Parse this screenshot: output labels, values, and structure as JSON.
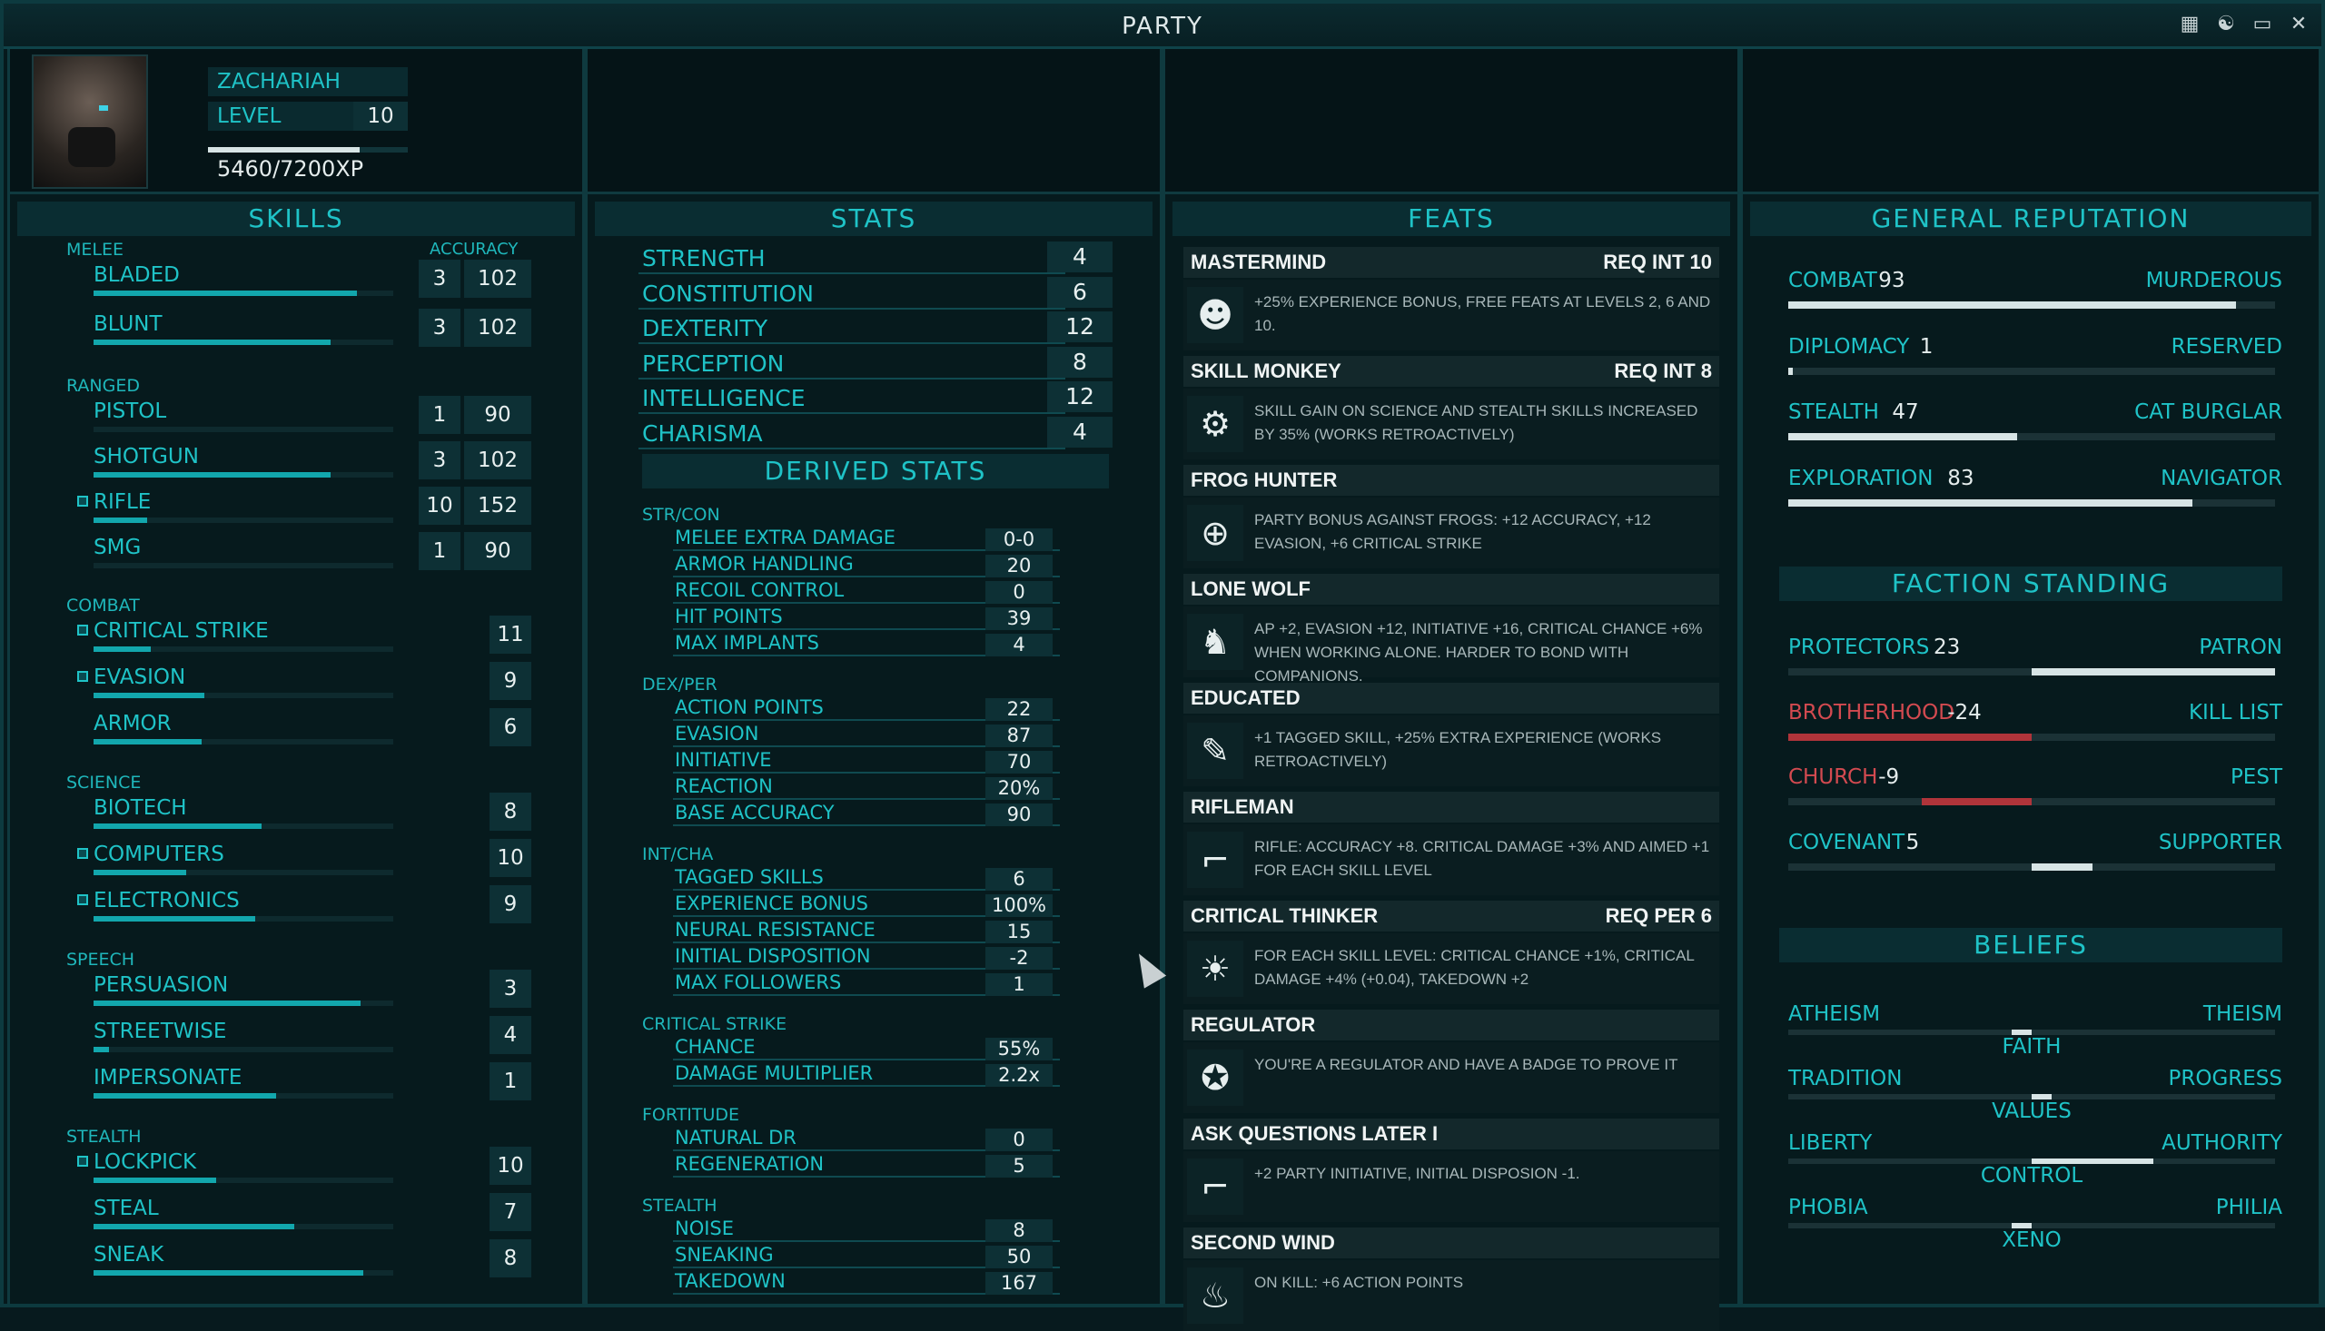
{
  "window": {
    "title": "PARTY"
  },
  "character": {
    "name": "ZACHARIAH",
    "level_label": "LEVEL",
    "level": "10",
    "xp": "5460/7200XP",
    "xp_fraction": 0.758
  },
  "skills": {
    "title": "SKILLS",
    "accuracy_header": "ACCURACY",
    "groups": [
      {
        "name": "MELEE",
        "items": [
          {
            "name": "BLADED",
            "rank": "3",
            "acc": "102",
            "fill": 0.88,
            "tagged": false
          },
          {
            "name": "BLUNT",
            "rank": "3",
            "acc": "102",
            "fill": 0.79,
            "tagged": false
          }
        ]
      },
      {
        "name": "RANGED",
        "items": [
          {
            "name": "PISTOL",
            "rank": "1",
            "acc": "90",
            "fill": 0,
            "tagged": false
          },
          {
            "name": "SHOTGUN",
            "rank": "3",
            "acc": "102",
            "fill": 0.79,
            "tagged": false
          },
          {
            "name": "RIFLE",
            "rank": "10",
            "acc": "152",
            "fill": 0.18,
            "tagged": true
          },
          {
            "name": "SMG",
            "rank": "1",
            "acc": "90",
            "fill": 0,
            "tagged": false
          }
        ]
      },
      {
        "name": "COMBAT",
        "items": [
          {
            "name": "CRITICAL STRIKE",
            "rank": "11",
            "fill": 0.19,
            "tagged": true
          },
          {
            "name": "EVASION",
            "rank": "9",
            "fill": 0.37,
            "tagged": true
          },
          {
            "name": "ARMOR",
            "rank": "6",
            "fill": 0.36,
            "tagged": false
          }
        ]
      },
      {
        "name": "SCIENCE",
        "items": [
          {
            "name": "BIOTECH",
            "rank": "8",
            "fill": 0.56,
            "tagged": false
          },
          {
            "name": "COMPUTERS",
            "rank": "10",
            "fill": 0.31,
            "tagged": true
          },
          {
            "name": "ELECTRONICS",
            "rank": "9",
            "fill": 0.54,
            "tagged": true
          }
        ]
      },
      {
        "name": "SPEECH",
        "items": [
          {
            "name": "PERSUASION",
            "rank": "3",
            "fill": 0.89,
            "tagged": false
          },
          {
            "name": "STREETWISE",
            "rank": "4",
            "fill": 0.05,
            "tagged": false
          },
          {
            "name": "IMPERSONATE",
            "rank": "1",
            "fill": 0.61,
            "tagged": false
          }
        ]
      },
      {
        "name": "STEALTH",
        "items": [
          {
            "name": "LOCKPICK",
            "rank": "10",
            "fill": 0.41,
            "tagged": true
          },
          {
            "name": "STEAL",
            "rank": "7",
            "fill": 0.67,
            "tagged": false
          },
          {
            "name": "SNEAK",
            "rank": "8",
            "fill": 0.9,
            "tagged": false
          }
        ]
      }
    ]
  },
  "stats": {
    "title": "STATS",
    "items": [
      {
        "name": "STRENGTH",
        "value": "4"
      },
      {
        "name": "CONSTITUTION",
        "value": "6"
      },
      {
        "name": "DEXTERITY",
        "value": "12"
      },
      {
        "name": "PERCEPTION",
        "value": "8"
      },
      {
        "name": "INTELLIGENCE",
        "value": "12"
      },
      {
        "name": "CHARISMA",
        "value": "4"
      }
    ]
  },
  "derived": {
    "title": "DERIVED STATS",
    "groups": [
      {
        "name": "STR/CON",
        "items": [
          {
            "name": "MELEE EXTRA DAMAGE",
            "value": "0-0"
          },
          {
            "name": "ARMOR HANDLING",
            "value": "20"
          },
          {
            "name": "RECOIL CONTROL",
            "value": "0"
          },
          {
            "name": "HIT POINTS",
            "value": "39"
          },
          {
            "name": "MAX IMPLANTS",
            "value": "4"
          }
        ]
      },
      {
        "name": "DEX/PER",
        "items": [
          {
            "name": "ACTION POINTS",
            "value": "22"
          },
          {
            "name": "EVASION",
            "value": "87"
          },
          {
            "name": "INITIATIVE",
            "value": "70"
          },
          {
            "name": "REACTION",
            "value": "20%"
          },
          {
            "name": "BASE ACCURACY",
            "value": "90"
          }
        ]
      },
      {
        "name": "INT/CHA",
        "items": [
          {
            "name": "TAGGED SKILLS",
            "value": "6"
          },
          {
            "name": "EXPERIENCE BONUS",
            "value": "100%"
          },
          {
            "name": "NEURAL RESISTANCE",
            "value": "15"
          },
          {
            "name": "INITIAL DISPOSITION",
            "value": "-2"
          },
          {
            "name": "MAX FOLLOWERS",
            "value": "1"
          }
        ]
      },
      {
        "name": "CRITICAL STRIKE",
        "items": [
          {
            "name": "CHANCE",
            "value": "55%"
          },
          {
            "name": "DAMAGE MULTIPLIER",
            "value": "2.2x"
          }
        ]
      },
      {
        "name": "FORTITUDE",
        "items": [
          {
            "name": "NATURAL DR",
            "value": "0"
          },
          {
            "name": "REGENERATION",
            "value": "5"
          }
        ]
      },
      {
        "name": "STEALTH",
        "items": [
          {
            "name": "NOISE",
            "value": "8"
          },
          {
            "name": "SNEAKING",
            "value": "50"
          },
          {
            "name": "TAKEDOWN",
            "value": "167"
          }
        ]
      }
    ]
  },
  "feats": {
    "title": "FEATS",
    "items": [
      {
        "name": "MASTERMIND",
        "req": "REQ INT 10",
        "icon": "brain-head-icon",
        "glyph": "☻",
        "desc": "+25% EXPERIENCE BONUS, FREE FEATS AT LEVELS 2, 6 AND 10."
      },
      {
        "name": "SKILL MONKEY",
        "req": "REQ INT 8",
        "icon": "gear-icon",
        "glyph": "⚙",
        "desc": "SKILL GAIN ON SCIENCE AND STEALTH SKILLS INCREASED BY 35% (WORKS RETROACTIVELY)"
      },
      {
        "name": "FROG HUNTER",
        "req": "",
        "icon": "crosshair-frog-icon",
        "glyph": "⊕",
        "desc": "PARTY BONUS AGAINST FROGS: +12 ACCURACY, +12 EVASION, +6 CRITICAL STRIKE"
      },
      {
        "name": "LONE WOLF",
        "req": "",
        "icon": "wolf-icon",
        "glyph": "♞",
        "desc": "AP +2, EVASION +12, INITIATIVE +16, CRITICAL CHANCE +6% WHEN WORKING ALONE. HARDER TO BOND WITH COMPANIONS."
      },
      {
        "name": "EDUCATED",
        "req": "",
        "icon": "book-icon",
        "glyph": "✎",
        "desc": "+1 TAGGED SKILL, +25% EXTRA EXPERIENCE (WORKS RETROACTIVELY)"
      },
      {
        "name": "RIFLEMAN",
        "req": "",
        "icon": "rifle-icon",
        "glyph": "⌐",
        "desc": "RIFLE: ACCURACY +8. CRITICAL DAMAGE +3% AND AIMED +1 FOR EACH SKILL LEVEL"
      },
      {
        "name": "CRITICAL THINKER",
        "req": "REQ PER 6",
        "icon": "lightbulb-icon",
        "glyph": "☀",
        "desc": "FOR EACH SKILL LEVEL: CRITICAL CHANCE +1%, CRITICAL DAMAGE +4% (+0.04), TAKEDOWN +2"
      },
      {
        "name": "REGULATOR",
        "req": "",
        "icon": "badge-star-icon",
        "glyph": "✪",
        "desc": "YOU'RE A REGULATOR AND HAVE A BADGE TO PROVE IT"
      },
      {
        "name": "ASK QUESTIONS LATER I",
        "req": "",
        "icon": "pistol-icon",
        "glyph": "⌐",
        "desc": "+2 PARTY INITIATIVE, INITIAL DISPOSION -1."
      },
      {
        "name": "SECOND WIND",
        "req": "",
        "icon": "lungs-icon",
        "glyph": "♨",
        "desc": "ON KILL: +6 ACTION POINTS"
      }
    ]
  },
  "reputation": {
    "title": "GENERAL REPUTATION",
    "items": [
      {
        "name": "COMBAT",
        "value": "93",
        "rank": "MURDEROUS",
        "fill": 0.92
      },
      {
        "name": "DIPLOMACY",
        "value": "1",
        "rank": "RESERVED",
        "fill": 0.01
      },
      {
        "name": "STEALTH",
        "value": "47",
        "rank": "CAT BURGLAR",
        "fill": 0.47
      },
      {
        "name": "EXPLORATION",
        "value": "83",
        "rank": "NAVIGATOR",
        "fill": 0.83
      }
    ]
  },
  "factions": {
    "title": "FACTION STANDING",
    "items": [
      {
        "name": "PROTECTORS",
        "value": "23",
        "rank": "PATRON",
        "pos": 0.23
      },
      {
        "name": "BROTHERHOOD",
        "value": "-24",
        "rank": "KILL LIST",
        "pos": -1.0
      },
      {
        "name": "CHURCH",
        "value": "-9",
        "rank": "PEST",
        "pos": -0.45
      },
      {
        "name": "COVENANT",
        "value": "5",
        "rank": "SUPPORTER",
        "pos": 0.25
      }
    ]
  },
  "beliefs": {
    "title": "BELIEFS",
    "items": [
      {
        "left": "ATHEISM",
        "right": "THEISM",
        "axis": "FAITH",
        "pos": -0.08
      },
      {
        "left": "TRADITION",
        "right": "PROGRESS",
        "axis": "VALUES",
        "pos": 0.05
      },
      {
        "left": "LIBERTY",
        "right": "AUTHORITY",
        "axis": "CONTROL",
        "pos": 0.5
      },
      {
        "left": "PHOBIA",
        "right": "PHILIA",
        "axis": "XENO",
        "pos": -0.08
      }
    ]
  }
}
